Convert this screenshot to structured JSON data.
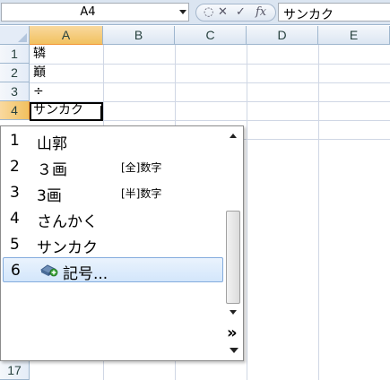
{
  "formula_bar": {
    "name_box": "A4",
    "formula_text": "サンカク",
    "fx_symbol": "fx"
  },
  "columns": [
    "A",
    "B",
    "C",
    "D",
    "E"
  ],
  "active_column": "A",
  "rows": [
    {
      "number": "1",
      "a": "辚"
    },
    {
      "number": "2",
      "a": "巔"
    },
    {
      "number": "3",
      "a": "÷"
    },
    {
      "number": "4",
      "a": "サンカク"
    },
    {
      "number": "17",
      "a": ""
    }
  ],
  "active_row": "4",
  "ime_candidates": [
    {
      "number": "1",
      "text": "山郭",
      "note": ""
    },
    {
      "number": "2",
      "text": "３画",
      "note": "[全]数字"
    },
    {
      "number": "3",
      "text": "3画",
      "note": "[半]数字"
    },
    {
      "number": "4",
      "text": "さんかく",
      "note": ""
    },
    {
      "number": "5",
      "text": "サンカク",
      "note": ""
    },
    {
      "number": "6",
      "text": "記号...",
      "note": "",
      "icon": "symbol-icon",
      "selected": true
    }
  ],
  "ime_controls": {
    "expand_symbol": "»"
  },
  "colors": {
    "active_header": "#f1c15f",
    "selection_border": "#84acdd",
    "grid_line": "#d0d7e5"
  }
}
